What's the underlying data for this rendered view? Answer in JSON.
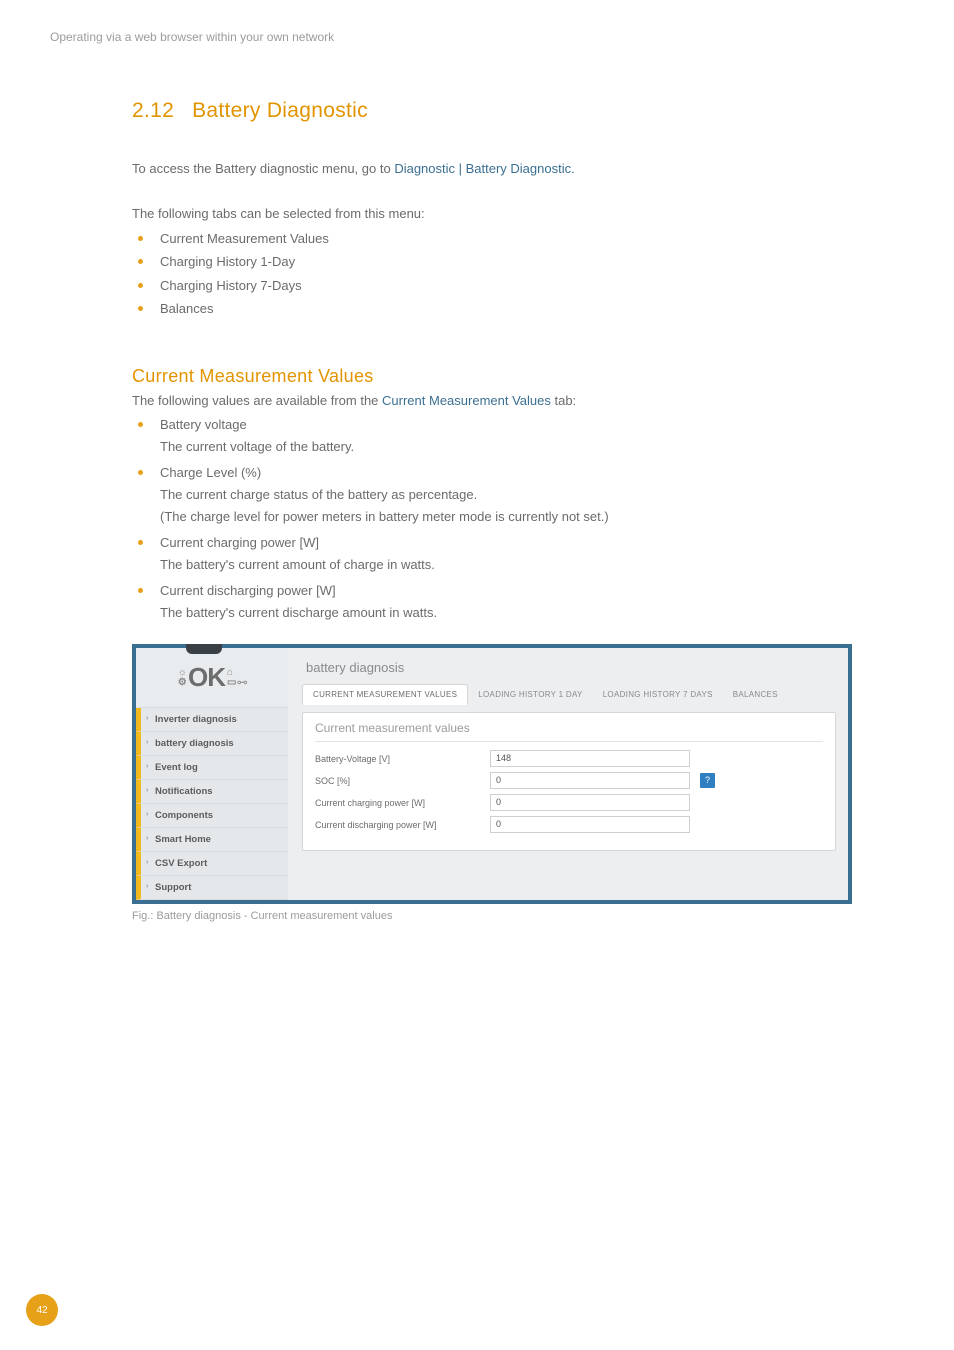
{
  "header": {
    "running": "Operating via a web browser within your own network"
  },
  "section": {
    "number": "2.12",
    "title": "Battery Diagnostic"
  },
  "intro": {
    "prefix": "To access the Battery diagnostic menu, go to ",
    "nav_path": "Diagnostic | Battery Diagnostic."
  },
  "tabs_lead": "The following tabs can be selected from this menu:",
  "tabs_list": [
    "Current Measurement Values",
    "Charging History 1-Day",
    "Charging History 7-Days",
    "Balances"
  ],
  "cmv": {
    "heading": "Current Measurement Values",
    "lead_prefix": "The following values are available from the ",
    "lead_tab": "Current Measurement Values",
    "lead_suffix": " tab:",
    "items": [
      {
        "title": "Battery voltage",
        "desc": [
          "The current voltage of the battery."
        ]
      },
      {
        "title": "Charge Level (%)",
        "desc": [
          "The current charge status of the battery as percentage.",
          "(The charge level for power meters in battery meter mode is currently not set.)"
        ]
      },
      {
        "title": "Current charging power [W]",
        "desc": [
          "The battery's current amount of charge in watts."
        ]
      },
      {
        "title": "Current discharging power [W]",
        "desc": [
          "The battery's current discharge amount in watts."
        ]
      }
    ]
  },
  "figure": {
    "logo_text": "OK",
    "nav": [
      "Inverter diagnosis",
      "battery diagnosis",
      "Event log",
      "Notifications",
      "Components",
      "Smart Home",
      "CSV Export",
      "Support"
    ],
    "panel_title": "battery diagnosis",
    "tabs": [
      "CURRENT MEASUREMENT VALUES",
      "LOADING HISTORY 1 DAY",
      "LOADING HISTORY 7 DAYS",
      "BALANCES"
    ],
    "card_heading": "Current measurement values",
    "rows": [
      {
        "label": "Battery-Voltage [V]",
        "value": "148",
        "help": false
      },
      {
        "label": "SOC [%]",
        "value": "0",
        "help": true
      },
      {
        "label": "Current charging power [W]",
        "value": "0",
        "help": false
      },
      {
        "label": "Current discharging power [W]",
        "value": "0",
        "help": false
      }
    ],
    "help_glyph": "?",
    "caption": "Fig.: Battery diagnosis - Current measurement values"
  },
  "page_number": "42"
}
